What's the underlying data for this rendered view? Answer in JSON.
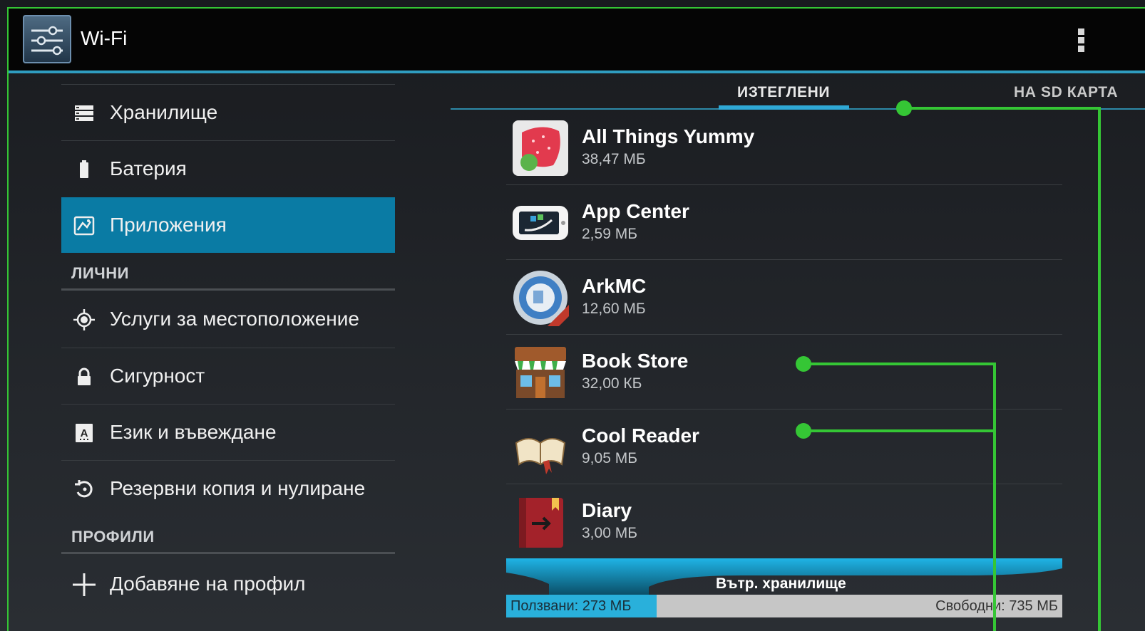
{
  "actionbar": {
    "title": "Wi-Fi",
    "icon": "settings-sliders-icon",
    "overflow_icon": "overflow-menu-icon"
  },
  "sidebar": {
    "items_top": [
      {
        "label": "Хранилище",
        "icon": "storage-icon"
      },
      {
        "label": "Батерия",
        "icon": "battery-icon"
      },
      {
        "label": "Приложения",
        "icon": "apps-icon",
        "active": true
      }
    ],
    "section_personal": "ЛИЧНИ",
    "items_personal": [
      {
        "label": "Услуги за местоположение",
        "icon": "location-icon"
      },
      {
        "label": "Сигурност",
        "icon": "lock-icon"
      },
      {
        "label": "Език и въвеждане",
        "icon": "language-icon"
      },
      {
        "label": "Резервни копия и нулиране",
        "icon": "backup-icon"
      }
    ],
    "section_accounts": "ПРОФИЛИ",
    "add_account": {
      "label": "Добавяне на профил",
      "icon": "plus-icon"
    }
  },
  "tabs": [
    {
      "label": "ИЗТЕГЛЕНИ",
      "active": true
    },
    {
      "label": "НА SD КАРТА",
      "active": false
    }
  ],
  "apps": [
    {
      "name": "All Things Yummy",
      "size": "38,47 МБ",
      "icon": "yummy-app-icon"
    },
    {
      "name": "App Center",
      "size": "2,59 МБ",
      "icon": "app-center-icon"
    },
    {
      "name": "ArkMC",
      "size": "12,60 МБ",
      "icon": "arkmc-icon"
    },
    {
      "name": "Book Store",
      "size": "32,00 КБ",
      "icon": "book-store-icon"
    },
    {
      "name": "Cool Reader",
      "size": "9,05 МБ",
      "icon": "cool-reader-icon"
    },
    {
      "name": "Diary",
      "size": "3,00 МБ",
      "icon": "diary-icon"
    }
  ],
  "storage": {
    "label": "Вътр. хранилище",
    "used": "Ползвани: 273 МБ",
    "free": "Свободни: 735 МБ",
    "used_fraction": 0.27
  },
  "colors": {
    "accent": "#0a7ba4",
    "highlight": "#2fa8d5",
    "callout": "#35c635"
  }
}
